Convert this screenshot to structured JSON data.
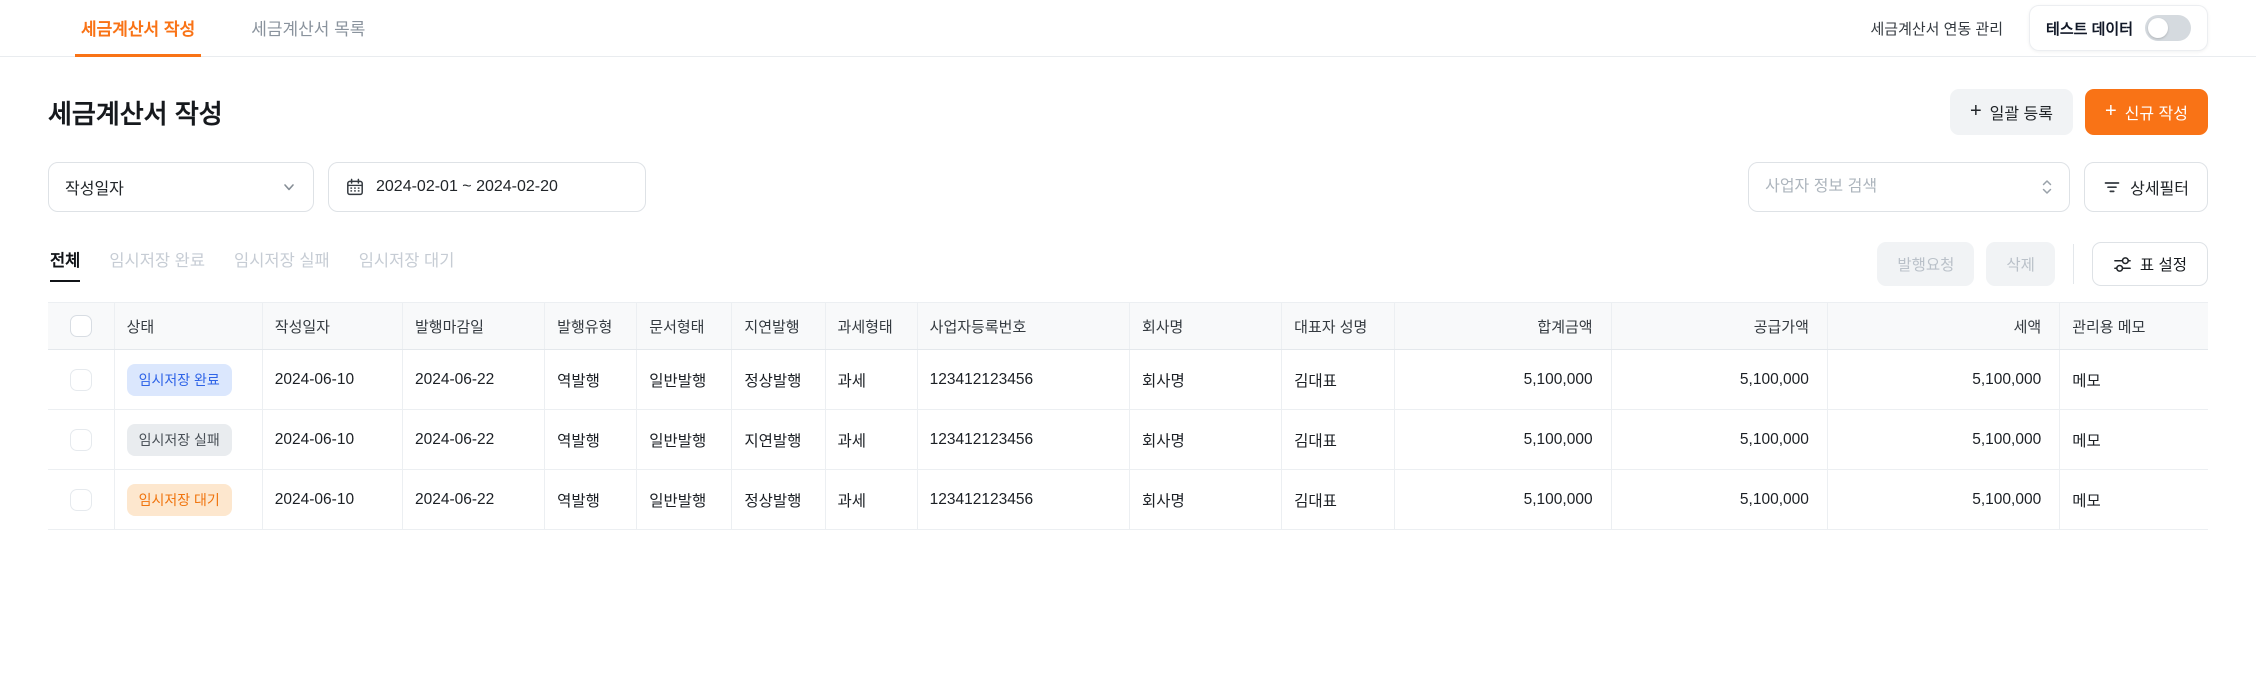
{
  "topbar": {
    "tabs": [
      {
        "label": "세금계산서 작성",
        "active": true
      },
      {
        "label": "세금계산서 목록",
        "active": false
      }
    ],
    "integration_link": "세금계산서 연동 관리",
    "test_data_label": "테스트 데이터",
    "test_data_toggle_on": false
  },
  "header": {
    "title": "세금계산서 작성",
    "bulk_register_label": "일괄 등록",
    "new_create_label": "신규 작성"
  },
  "filters": {
    "date_type_value": "작성일자",
    "date_range_value": "2024-02-01 ~ 2024-02-20",
    "search_placeholder": "사업자 정보 검색",
    "detail_filter_label": "상세필터"
  },
  "status_tabs": [
    {
      "label": "전체",
      "active": true
    },
    {
      "label": "임시저장 완료",
      "active": false
    },
    {
      "label": "임시저장 실패",
      "active": false
    },
    {
      "label": "임시저장 대기",
      "active": false
    }
  ],
  "actions": {
    "request_publish_label": "발행요청",
    "delete_label": "삭제",
    "table_settings_label": "표 설정"
  },
  "table": {
    "columns": [
      {
        "key": "status",
        "label": "상태"
      },
      {
        "key": "created",
        "label": "작성일자"
      },
      {
        "key": "deadline",
        "label": "발행마감일"
      },
      {
        "key": "issue_type",
        "label": "발행유형"
      },
      {
        "key": "doc_type",
        "label": "문서형태"
      },
      {
        "key": "delay",
        "label": "지연발행"
      },
      {
        "key": "tax_type",
        "label": "과세형태"
      },
      {
        "key": "biz_no",
        "label": "사업자등록번호"
      },
      {
        "key": "company",
        "label": "회사명"
      },
      {
        "key": "ceo",
        "label": "대표자 성명"
      },
      {
        "key": "total",
        "label": "합계금액",
        "align": "right"
      },
      {
        "key": "supply",
        "label": "공급가액",
        "align": "right"
      },
      {
        "key": "tax",
        "label": "세액",
        "align": "right"
      },
      {
        "key": "memo",
        "label": "관리용 메모"
      }
    ],
    "rows": [
      {
        "status": "임시저장 완료",
        "variant": "complete",
        "created": "2024-06-10",
        "deadline": "2024-06-22",
        "issue_type": "역발행",
        "doc_type": "일반발행",
        "delay": "정상발행",
        "tax_type": "과세",
        "biz_no": "123412123456",
        "company": "회사명",
        "ceo": "김대표",
        "total": "5,100,000",
        "supply": "5,100,000",
        "tax": "5,100,000",
        "memo": "메모"
      },
      {
        "status": "임시저장 실패",
        "variant": "fail",
        "created": "2024-06-10",
        "deadline": "2024-06-22",
        "issue_type": "역발행",
        "doc_type": "일반발행",
        "delay": "지연발행",
        "tax_type": "과세",
        "biz_no": "123412123456",
        "company": "회사명",
        "ceo": "김대표",
        "total": "5,100,000",
        "supply": "5,100,000",
        "tax": "5,100,000",
        "memo": "메모"
      },
      {
        "status": "임시저장 대기",
        "variant": "wait",
        "created": "2024-06-10",
        "deadline": "2024-06-22",
        "issue_type": "역발행",
        "doc_type": "일반발행",
        "delay": "정상발행",
        "tax_type": "과세",
        "biz_no": "123412123456",
        "company": "회사명",
        "ceo": "김대표",
        "total": "5,100,000",
        "supply": "5,100,000",
        "tax": "5,100,000",
        "memo": "메모"
      }
    ]
  },
  "colors": {
    "accent": "#F97316",
    "badge_complete_bg": "#DBE7FD",
    "badge_complete_text": "#2E63E7",
    "badge_fail_bg": "#E9ECEF",
    "badge_fail_text": "#495057",
    "badge_wait_bg": "#FDE7CE",
    "badge_wait_text": "#F0740E"
  }
}
